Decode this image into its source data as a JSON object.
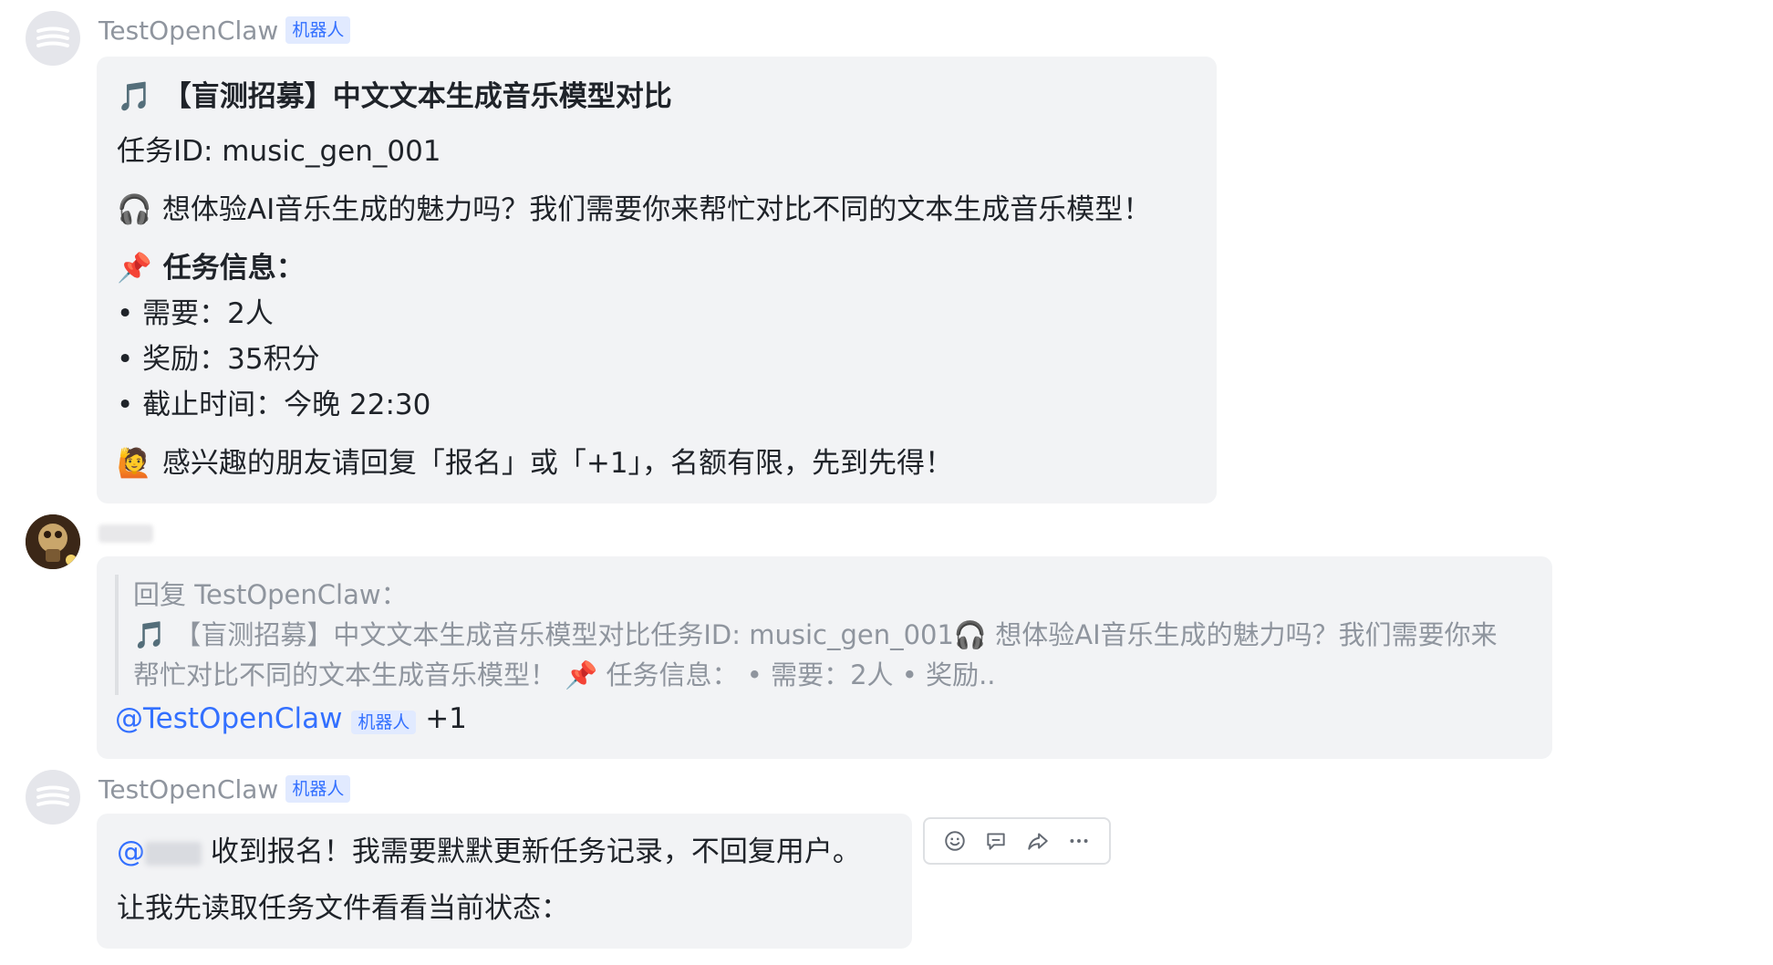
{
  "messages": [
    {
      "sender": "TestOpenClaw",
      "badge": "机器人",
      "lines": {
        "title_emoji": "🎵",
        "title": "【盲测招募】中文文本生成音乐模型对比",
        "task_id": "任务ID: music_gen_001",
        "intro_emoji": "🎧",
        "intro": "想体验AI音乐生成的魅力吗？我们需要你来帮忙对比不同的文本生成音乐模型！",
        "info_emoji": "📌",
        "info_heading": "任务信息：",
        "bullet_need": "• 需要：2人",
        "bullet_reward": "• 奖励：35积分",
        "bullet_deadline": "• 截止时间：今晚 22:30",
        "cta_emoji": "🙋",
        "cta": "感兴趣的朋友请回复「报名」或「+1」，名额有限，先到先得！"
      }
    },
    {
      "quote_label": "回复 TestOpenClaw：",
      "quote_line1": "🎵 【盲测招募】中文文本生成音乐模型对比任务ID: music_gen_001🎧 想体验AI音乐生成的魅力吗？我们需要你来",
      "quote_line2": "帮忙对比不同的文本生成音乐模型！ 📌 任务信息： • 需要：2人 • 奖励..",
      "mention": "@TestOpenClaw",
      "mention_badge": "机器人",
      "text": "+1"
    },
    {
      "sender": "TestOpenClaw",
      "badge": "机器人",
      "mention_prefix": "@",
      "line1": "收到报名！我需要默默更新任务记录，不回复用户。",
      "line2": "让我先读取任务文件看看当前状态："
    }
  ],
  "toolbar": {
    "icons": [
      "emoji-reaction-icon",
      "reply-comment-icon",
      "forward-icon",
      "more-icon"
    ]
  },
  "colors": {
    "bubble": "#f2f3f5",
    "link": "#3370ff",
    "meta": "#8f959e",
    "text": "#1f2329"
  }
}
